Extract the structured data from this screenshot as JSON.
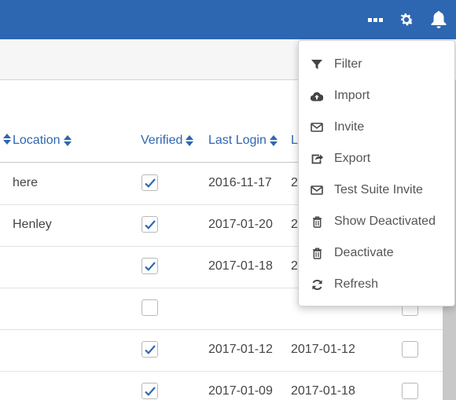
{
  "topbar": {
    "icons": [
      "more-icon",
      "gear-icon",
      "bell-icon"
    ],
    "color": "#2e67b1"
  },
  "table": {
    "headers": {
      "location": "Location",
      "verified": "Verified",
      "last_login": "Last Login",
      "truncated": "L"
    },
    "rows": [
      {
        "location": "here",
        "verified": true,
        "last_login": "2016-11-17",
        "last": "2",
        "side_checked": null
      },
      {
        "location": "Henley",
        "verified": true,
        "last_login": "2017-01-20",
        "last": "2",
        "side_checked": null
      },
      {
        "location": "",
        "verified": true,
        "last_login": "2017-01-18",
        "last": "2",
        "side_checked": null
      },
      {
        "location": "",
        "verified": false,
        "last_login": "",
        "last": "",
        "side_checked": false
      },
      {
        "location": "",
        "verified": true,
        "last_login": "2017-01-12",
        "last": "2017-01-12",
        "side_checked": false
      },
      {
        "location": "",
        "verified": true,
        "last_login": "2017-01-09",
        "last": "2017-01-18",
        "side_checked": false
      }
    ]
  },
  "menu": {
    "items": [
      {
        "label": "Filter",
        "icon": "filter-icon"
      },
      {
        "label": "Import",
        "icon": "cloud-upload-icon"
      },
      {
        "label": "Invite",
        "icon": "envelope-icon"
      },
      {
        "label": "Export",
        "icon": "share-icon"
      },
      {
        "label": "Test Suite Invite",
        "icon": "envelope-icon"
      },
      {
        "label": "Show Deactivated",
        "icon": "trash-icon"
      },
      {
        "label": "Deactivate",
        "icon": "trash-icon"
      },
      {
        "label": "Refresh",
        "icon": "refresh-icon"
      }
    ]
  },
  "colors": {
    "accent": "#2e67b1",
    "check": "#2e67b1"
  }
}
